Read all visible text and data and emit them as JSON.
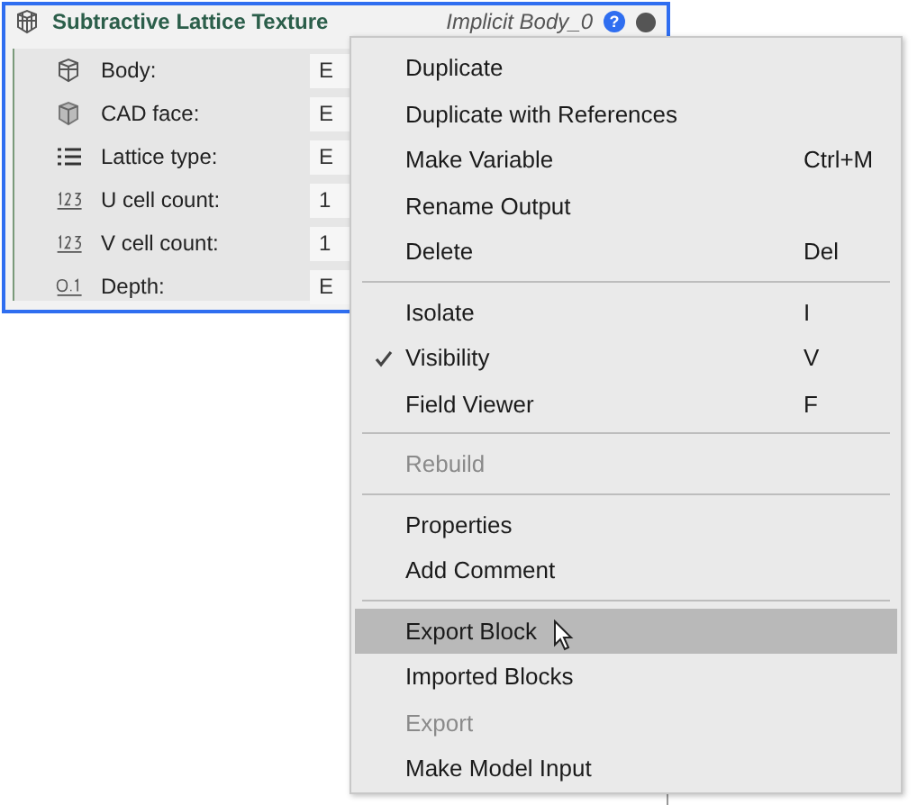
{
  "block": {
    "title": "Subtractive Lattice Texture",
    "output": "Implicit Body_0",
    "help": "?",
    "fields": [
      {
        "kind": "body",
        "label": "Body:",
        "value": "E"
      },
      {
        "kind": "cad",
        "label": "CAD face:",
        "value": "E"
      },
      {
        "kind": "list",
        "label": "Lattice type:",
        "value": "E"
      },
      {
        "kind": "int",
        "label": "U cell count:",
        "value": "1"
      },
      {
        "kind": "int",
        "label": "V cell count:",
        "value": "1"
      },
      {
        "kind": "real",
        "label": "Depth:",
        "value": "E"
      }
    ]
  },
  "menu": [
    {
      "kind": "item",
      "label": "Duplicate",
      "checked": false,
      "disabled": false,
      "selected": false
    },
    {
      "kind": "item",
      "label": "Duplicate with References",
      "checked": false,
      "disabled": false,
      "selected": false
    },
    {
      "kind": "item",
      "label": "Make Variable",
      "shortcut": "Ctrl+M",
      "checked": false,
      "disabled": false,
      "selected": false
    },
    {
      "kind": "item",
      "label": "Rename Output",
      "checked": false,
      "disabled": false,
      "selected": false
    },
    {
      "kind": "item",
      "label": "Delete",
      "shortcut": "Del",
      "checked": false,
      "disabled": false,
      "selected": false
    },
    {
      "kind": "separator"
    },
    {
      "kind": "item",
      "label": "Isolate",
      "shortcut": "I",
      "checked": false,
      "disabled": false,
      "selected": false
    },
    {
      "kind": "item",
      "label": "Visibility",
      "shortcut": "V",
      "checked": true,
      "disabled": false,
      "selected": false
    },
    {
      "kind": "item",
      "label": "Field Viewer",
      "shortcut": "F",
      "checked": false,
      "disabled": false,
      "selected": false
    },
    {
      "kind": "separator"
    },
    {
      "kind": "item",
      "label": "Rebuild",
      "checked": false,
      "disabled": true,
      "selected": false
    },
    {
      "kind": "separator"
    },
    {
      "kind": "item",
      "label": "Properties",
      "checked": false,
      "disabled": false,
      "selected": false
    },
    {
      "kind": "item",
      "label": "Add Comment",
      "checked": false,
      "disabled": false,
      "selected": false
    },
    {
      "kind": "separator"
    },
    {
      "kind": "item",
      "label": "Export Block",
      "checked": false,
      "disabled": false,
      "selected": true
    },
    {
      "kind": "item",
      "label": "Imported Blocks",
      "checked": false,
      "disabled": false,
      "selected": false
    },
    {
      "kind": "item",
      "label": "Export",
      "checked": false,
      "disabled": true,
      "selected": false
    },
    {
      "kind": "item",
      "label": "Make Model Input",
      "checked": false,
      "disabled": false,
      "selected": false
    }
  ]
}
